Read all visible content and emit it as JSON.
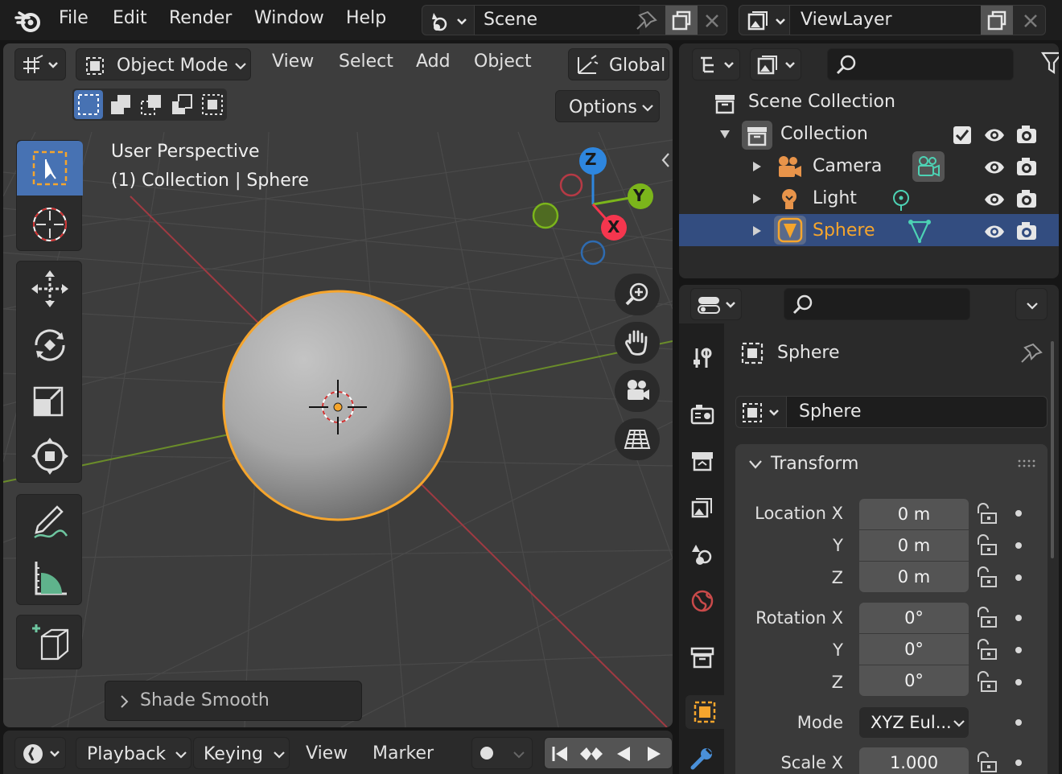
{
  "topbar": {
    "menus": [
      "File",
      "Edit",
      "Render",
      "Window",
      "Help"
    ],
    "scene": "Scene",
    "viewlayer": "ViewLayer"
  },
  "viewport_header": {
    "mode": "Object Mode",
    "menus": [
      "View",
      "Select",
      "Add",
      "Object"
    ],
    "orientation": "Global",
    "options": "Options"
  },
  "viewport": {
    "perspective": "User Perspective",
    "context": "(1) Collection | Sphere",
    "gizmo_axes": [
      "Z",
      "Y",
      "X"
    ],
    "last_op": "Shade Smooth"
  },
  "timeline": {
    "menus": [
      "Playback",
      "Keying",
      "View",
      "Marker"
    ]
  },
  "outliner": {
    "root": "Scene Collection",
    "collection": "Collection",
    "items": [
      {
        "name": "Camera",
        "selected": false
      },
      {
        "name": "Light",
        "selected": false
      },
      {
        "name": "Sphere",
        "selected": true
      }
    ]
  },
  "properties": {
    "object_name": "Sphere",
    "datablock": "Sphere",
    "panel": "Transform",
    "location": {
      "label_x": "Location X",
      "label_y": "Y",
      "label_z": "Z",
      "x": "0 m",
      "y": "0 m",
      "z": "0 m"
    },
    "rotation": {
      "label_x": "Rotation X",
      "label_y": "Y",
      "label_z": "Z",
      "x": "0°",
      "y": "0°",
      "z": "0°"
    },
    "mode_label": "Mode",
    "mode_value": "XYZ Eul...",
    "scale_label": "Scale X",
    "scale_x": "1.000"
  },
  "colors": {
    "accent_blue": "#4772b3",
    "selection_orange": "#f5a52d",
    "selected_row": "#334d80",
    "axis_x": "#f5364e",
    "axis_y": "#7bb51b",
    "axis_z": "#2e86de"
  }
}
